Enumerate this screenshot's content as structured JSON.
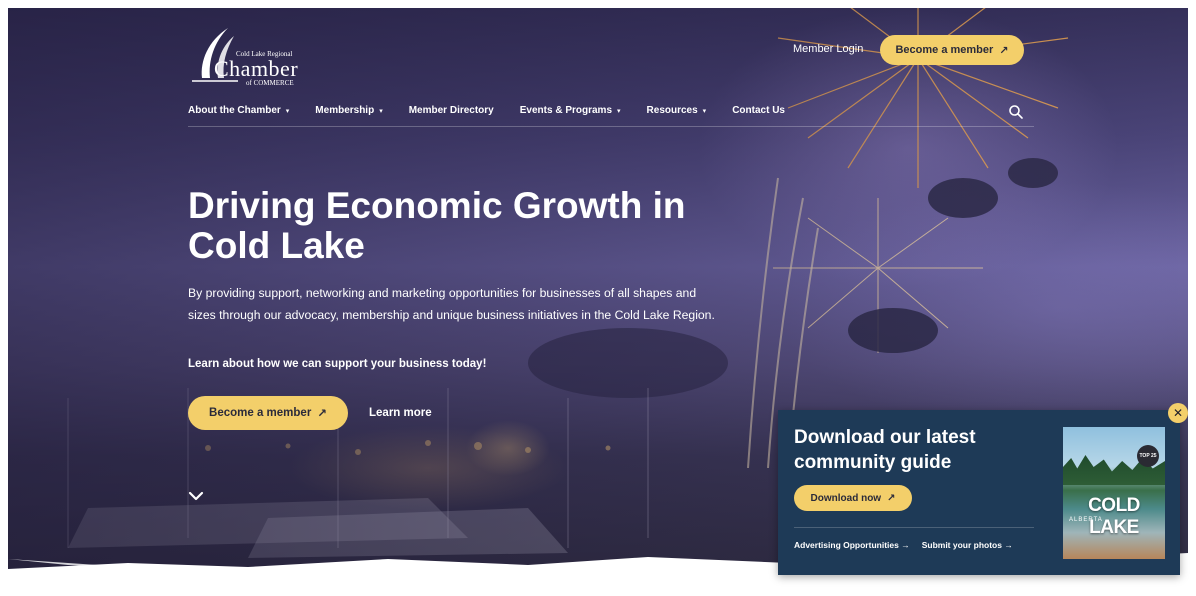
{
  "header": {
    "logo": {
      "line1": "Cold Lake Regional",
      "line2": "Chamber",
      "line3": "of COMMERCE"
    },
    "member_login": "Member Login",
    "become_member": "Become a member",
    "arrow": "↗"
  },
  "nav": {
    "items": [
      {
        "label": "About the Chamber",
        "dropdown": "▾"
      },
      {
        "label": "Membership",
        "dropdown": "▾"
      },
      {
        "label": "Member Directory",
        "dropdown": ""
      },
      {
        "label": "Events & Programs",
        "dropdown": "▾"
      },
      {
        "label": "Resources",
        "dropdown": "▾"
      },
      {
        "label": "Contact Us",
        "dropdown": ""
      }
    ]
  },
  "hero": {
    "headline": "Driving Economic Growth in Cold Lake",
    "intro": "By providing support, networking and marketing opportunities for businesses of all shapes and sizes through our advocacy, membership and unique business initiatives in the Cold Lake Region.",
    "cta_text": "Learn about how we can support your business today!",
    "become_member": "Become a member",
    "learn_more": "Learn more",
    "arrow": "↗"
  },
  "popup": {
    "title": "Download our latest community guide",
    "download": "Download now",
    "arrow": "↗",
    "links": [
      {
        "label": "Advertising Opportunities →"
      },
      {
        "label": "Submit your photos →"
      }
    ],
    "cover": {
      "title": "COLD LAKE",
      "subtitle": "ALBERTA",
      "badge": "TOP 25"
    },
    "close": "✕"
  },
  "colors": {
    "accent_yellow": "#f3cf6a",
    "popup_navy": "#1e3a57",
    "hero_purple": "#4a4478"
  },
  "icons": [
    "search-icon",
    "chevron-down-icon",
    "close-icon",
    "arrow-up-right-icon",
    "logo-sail-icon"
  ]
}
